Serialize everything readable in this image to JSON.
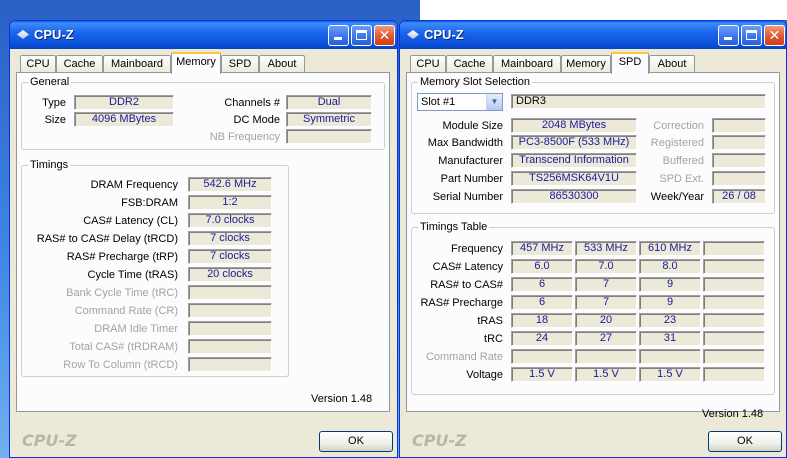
{
  "left": {
    "title": "CPU-Z",
    "tabs": [
      "CPU",
      "Cache",
      "Mainboard",
      "Memory",
      "SPD",
      "About"
    ],
    "active_tab": "Memory",
    "general": {
      "label": "General",
      "type_label": "Type",
      "type_value": "DDR2",
      "size_label": "Size",
      "size_value": "4096 MBytes",
      "channels_label": "Channels #",
      "channels_value": "Dual",
      "dcmode_label": "DC Mode",
      "dcmode_value": "Symmetric",
      "nbfreq_label": "NB Frequency",
      "nbfreq_value": ""
    },
    "timings": {
      "label": "Timings",
      "rows": [
        {
          "label": "DRAM Frequency",
          "value": "542.6 MHz",
          "enabled": true
        },
        {
          "label": "FSB:DRAM",
          "value": "1:2",
          "enabled": true
        },
        {
          "label": "CAS# Latency (CL)",
          "value": "7.0 clocks",
          "enabled": true
        },
        {
          "label": "RAS# to CAS# Delay (tRCD)",
          "value": "7 clocks",
          "enabled": true
        },
        {
          "label": "RAS# Precharge (tRP)",
          "value": "7 clocks",
          "enabled": true
        },
        {
          "label": "Cycle Time (tRAS)",
          "value": "20 clocks",
          "enabled": true
        },
        {
          "label": "Bank Cycle Time (tRC)",
          "value": "",
          "enabled": false
        },
        {
          "label": "Command Rate (CR)",
          "value": "",
          "enabled": false
        },
        {
          "label": "DRAM Idle Timer",
          "value": "",
          "enabled": false
        },
        {
          "label": "Total CAS# (tRDRAM)",
          "value": "",
          "enabled": false
        },
        {
          "label": "Row To Column (tRCD)",
          "value": "",
          "enabled": false
        }
      ]
    },
    "version": "Version 1.48",
    "brand": "CPU-Z",
    "ok_label": "OK"
  },
  "right": {
    "title": "CPU-Z",
    "tabs": [
      "CPU",
      "Cache",
      "Mainboard",
      "Memory",
      "SPD",
      "About"
    ],
    "active_tab": "SPD",
    "slot": {
      "label": "Memory Slot Selection",
      "selected": "Slot #1",
      "type_value": "DDR3",
      "module_size_label": "Module Size",
      "module_size_value": "2048 MBytes",
      "max_bw_label": "Max Bandwidth",
      "max_bw_value": "PC3-8500F (533 MHz)",
      "manufacturer_label": "Manufacturer",
      "manufacturer_value": "Transcend Information",
      "part_label": "Part Number",
      "part_value": "TS256MSK64V1U",
      "serial_label": "Serial Number",
      "serial_value": "86530300",
      "correction_label": "Correction",
      "correction_value": "",
      "registered_label": "Registered",
      "registered_value": "",
      "buffered_label": "Buffered",
      "buffered_value": "",
      "spdext_label": "SPD Ext.",
      "spdext_value": "",
      "weekyear_label": "Week/Year",
      "weekyear_value": "26 / 08"
    },
    "timings_table": {
      "label": "Timings Table",
      "rows": [
        {
          "label": "Frequency",
          "values": [
            "457 MHz",
            "533 MHz",
            "610 MHz",
            ""
          ],
          "enabled": true
        },
        {
          "label": "CAS# Latency",
          "values": [
            "6.0",
            "7.0",
            "8.0",
            ""
          ],
          "enabled": true
        },
        {
          "label": "RAS# to CAS#",
          "values": [
            "6",
            "7",
            "9",
            ""
          ],
          "enabled": true
        },
        {
          "label": "RAS# Precharge",
          "values": [
            "6",
            "7",
            "9",
            ""
          ],
          "enabled": true
        },
        {
          "label": "tRAS",
          "values": [
            "18",
            "20",
            "23",
            ""
          ],
          "enabled": true
        },
        {
          "label": "tRC",
          "values": [
            "24",
            "27",
            "31",
            ""
          ],
          "enabled": true
        },
        {
          "label": "Command Rate",
          "values": [
            "",
            "",
            "",
            ""
          ],
          "enabled": false
        },
        {
          "label": "Voltage",
          "values": [
            "1.5 V",
            "1.5 V",
            "1.5 V",
            ""
          ],
          "enabled": true
        }
      ]
    },
    "version": "Version 1.48",
    "brand": "CPU-Z",
    "ok_label": "OK"
  }
}
